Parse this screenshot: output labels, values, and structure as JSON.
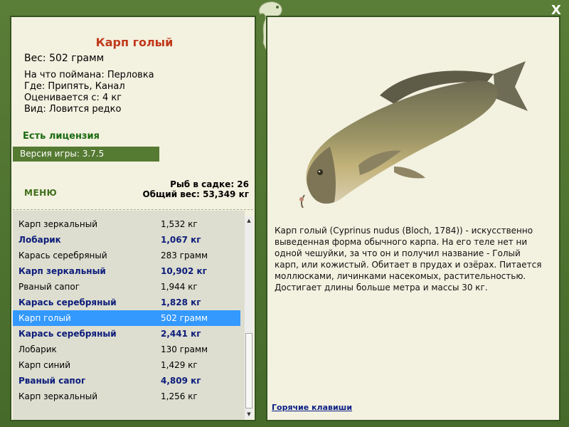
{
  "close_label": "X",
  "fish": {
    "title": "Карп голый",
    "weight": "Вес: 502 грамм",
    "caught_on": "На что поймана: Перловка",
    "where": "Где: Припять, Канал",
    "valued_from": "Оценивается с: 4 кг",
    "kind": "Вид: Ловится редко"
  },
  "license": "Есть лицензия",
  "version": "Версия игры: 3.7.5",
  "menu_label": "МЕНЮ",
  "stats": {
    "count": "Рыб в садке: 26",
    "total": "Общий вес: 53,349 кг"
  },
  "catch_list": [
    {
      "name": "Карп зеркальный",
      "weight": "1,532 кг",
      "bold": false,
      "selected": false
    },
    {
      "name": "Лобарик",
      "weight": "1,067 кг",
      "bold": true,
      "selected": false
    },
    {
      "name": "Карась серебряный",
      "weight": "283 грамм",
      "bold": false,
      "selected": false
    },
    {
      "name": "Карп зеркальный",
      "weight": "10,902 кг",
      "bold": true,
      "selected": false
    },
    {
      "name": "Рваный сапог",
      "weight": "1,944 кг",
      "bold": false,
      "selected": false
    },
    {
      "name": "Карась серебряный",
      "weight": "1,828 кг",
      "bold": true,
      "selected": false
    },
    {
      "name": "Карп голый",
      "weight": "502 грамм",
      "bold": false,
      "selected": true
    },
    {
      "name": "Карась серебряный",
      "weight": "2,441 кг",
      "bold": true,
      "selected": false
    },
    {
      "name": "Лобарик",
      "weight": "130 грамм",
      "bold": false,
      "selected": false
    },
    {
      "name": "Карп синий",
      "weight": "1,429 кг",
      "bold": false,
      "selected": false
    },
    {
      "name": "Рваный сапог",
      "weight": "4,809 кг",
      "bold": true,
      "selected": false
    },
    {
      "name": "Карп зеркальный",
      "weight": "1,256 кг",
      "bold": false,
      "selected": false
    }
  ],
  "description": "Карп голый (Cyprinus nudus (Bloch, 1784)) - искусственно выведенная форма обычного карпа. На его теле нет ни одной чешуйки, за что он и получил название - Голый карп, или кожистый. Обитает в прудах и озёрах. Питается моллюсками, личинками насекомых, растительностью. Достигает длины больше метра и массы 30 кг.",
  "hotkeys_label": "Горячие клавиши",
  "colors": {
    "frame": "#4b6f2f",
    "panel": "#f3f1e0",
    "title": "#c0391b",
    "license": "#1b6b12",
    "bold_row": "#0c1c7a",
    "selected_row": "#3399ff"
  },
  "icons": {
    "close": "close-icon",
    "emblem": "fish-emblem-icon",
    "scroll_up": "arrow-up-icon",
    "scroll_down": "arrow-down-icon"
  }
}
